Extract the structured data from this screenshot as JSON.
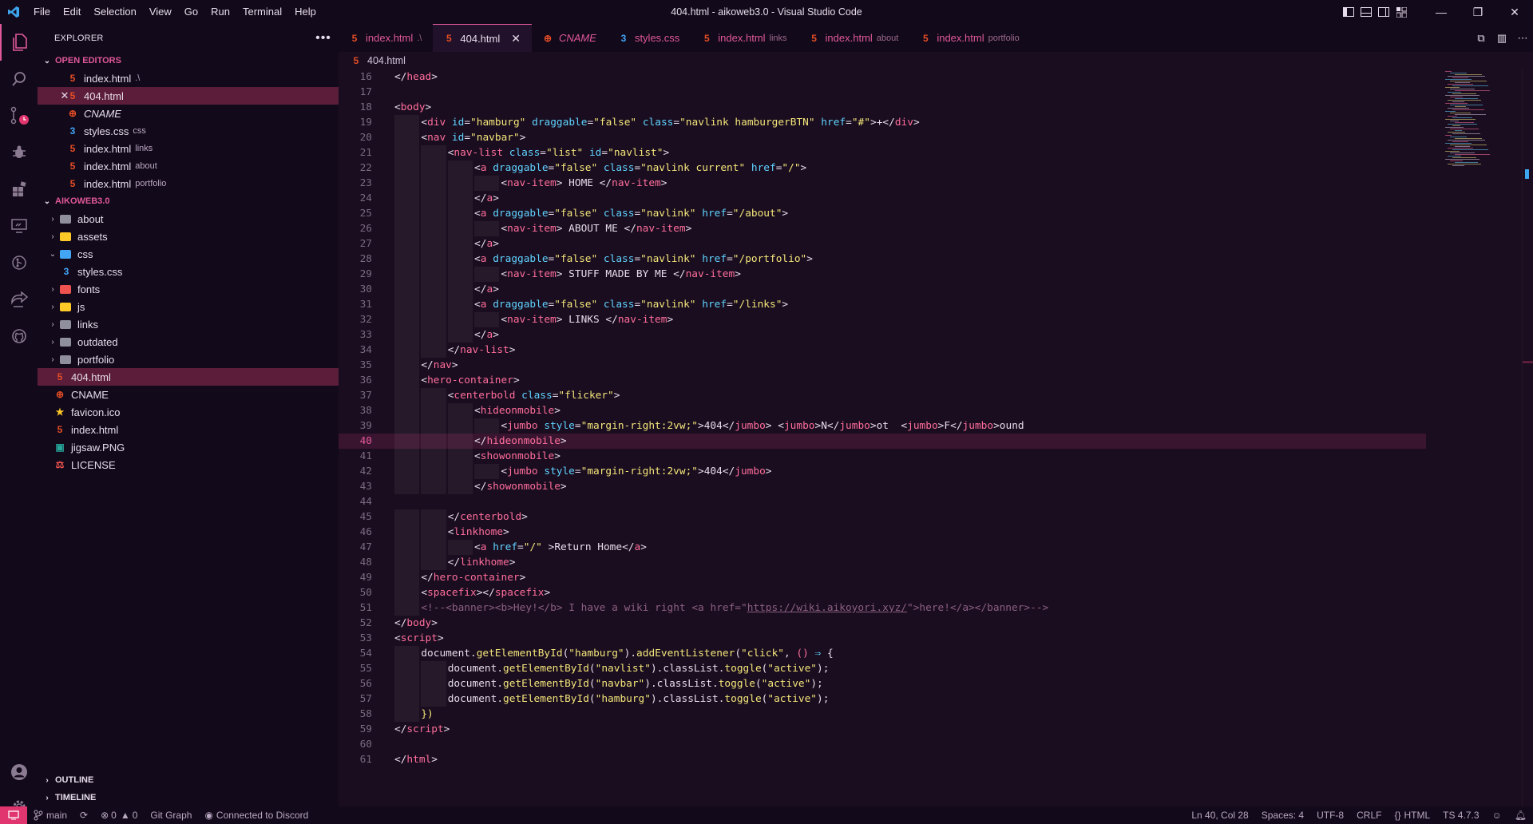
{
  "app": {
    "window_title": "404.html - aikoweb3.0 - Visual Studio Code",
    "menu": [
      "File",
      "Edit",
      "Selection",
      "View",
      "Go",
      "Run",
      "Terminal",
      "Help"
    ],
    "window_controls": {
      "minimize": "—",
      "restore": "❐",
      "close": "✕"
    }
  },
  "sidebar": {
    "title": "EXPLORER",
    "open_editors_label": "OPEN EDITORS",
    "open_editors": [
      {
        "name": "index.html",
        "desc": ".\\",
        "icon": "html-file-icon"
      },
      {
        "name": "404.html",
        "desc": "",
        "icon": "html-file-icon",
        "selected": true
      },
      {
        "name": "CNAME",
        "desc": "",
        "icon": "cname-file-icon"
      },
      {
        "name": "styles.css",
        "desc": "css",
        "icon": "css-file-icon"
      },
      {
        "name": "index.html",
        "desc": "links",
        "icon": "html-file-icon"
      },
      {
        "name": "index.html",
        "desc": "about",
        "icon": "html-file-icon"
      },
      {
        "name": "index.html",
        "desc": "portfolio",
        "icon": "html-file-icon"
      }
    ],
    "workspace_label": "AIKOWEB3.0",
    "tree": [
      {
        "name": "about",
        "type": "folder",
        "color": "#8f8f9e"
      },
      {
        "name": "assets",
        "type": "folder",
        "color": "#ffca28"
      },
      {
        "name": "css",
        "type": "folder-open",
        "color": "#42a5f5"
      },
      {
        "name": "styles.css",
        "type": "file-css",
        "nested": true
      },
      {
        "name": "fonts",
        "type": "folder",
        "color": "#ef5350"
      },
      {
        "name": "js",
        "type": "folder",
        "color": "#ffca28"
      },
      {
        "name": "links",
        "type": "folder",
        "color": "#8f8f9e"
      },
      {
        "name": "outdated",
        "type": "folder",
        "color": "#8f8f9e"
      },
      {
        "name": "portfolio",
        "type": "folder",
        "color": "#8f8f9e"
      },
      {
        "name": "404.html",
        "type": "file-html",
        "selected": true
      },
      {
        "name": "CNAME",
        "type": "file-cname"
      },
      {
        "name": "favicon.ico",
        "type": "file-star"
      },
      {
        "name": "index.html",
        "type": "file-html"
      },
      {
        "name": "jigsaw.PNG",
        "type": "file-image"
      },
      {
        "name": "LICENSE",
        "type": "file-license"
      }
    ],
    "outline_label": "OUTLINE",
    "timeline_label": "TIMELINE"
  },
  "tabs": [
    {
      "name": "index.html",
      "desc": ".\\",
      "active": false
    },
    {
      "name": "404.html",
      "desc": "",
      "active": true
    },
    {
      "name": "CNAME",
      "desc": "",
      "active": false,
      "italic": true
    },
    {
      "name": "styles.css",
      "desc": "",
      "active": false
    },
    {
      "name": "index.html",
      "desc": "links",
      "active": false
    },
    {
      "name": "index.html",
      "desc": "about",
      "active": false
    },
    {
      "name": "index.html",
      "desc": "portfolio",
      "active": false
    }
  ],
  "breadcrumb": "404.html",
  "code": {
    "current_line": 40,
    "lines": [
      {
        "n": 16,
        "indent": 0,
        "html": "<span class='pt'>&lt;/</span><span class='tg'>head</span><span class='pt'>&gt;</span>"
      },
      {
        "n": 17,
        "indent": 0,
        "html": ""
      },
      {
        "n": 18,
        "indent": 0,
        "html": "<span class='pt'>&lt;</span><span class='tg'>body</span><span class='pt'>&gt;</span>"
      },
      {
        "n": 19,
        "indent": 1,
        "html": "<span class='pt'>&lt;</span><span class='tg'>div</span> <span class='at'>id</span>=<span class='st'>\"hamburg\"</span> <span class='at'>draggable</span>=<span class='st'>\"false\"</span> <span class='at'>class</span>=<span class='st'>\"navlink hamburgerBTN\"</span> <span class='at'>href</span>=<span class='st'>\"#\"</span><span class='pt'>&gt;</span>+<span class='pt'>&lt;/</span><span class='tg'>div</span><span class='pt'>&gt;</span>"
      },
      {
        "n": 20,
        "indent": 1,
        "html": "<span class='pt'>&lt;</span><span class='tg'>nav</span> <span class='at'>id</span>=<span class='st'>\"navbar\"</span><span class='pt'>&gt;</span>"
      },
      {
        "n": 21,
        "indent": 2,
        "html": "<span class='pt'>&lt;</span><span class='tg'>nav-list</span> <span class='at'>class</span>=<span class='st'>\"list\"</span> <span class='at'>id</span>=<span class='st'>\"navlist\"</span><span class='pt'>&gt;</span>"
      },
      {
        "n": 22,
        "indent": 3,
        "html": "<span class='pt'>&lt;</span><span class='tg'>a</span> <span class='at'>draggable</span>=<span class='st'>\"false\"</span> <span class='at'>class</span>=<span class='st'>\"navlink current\"</span> <span class='at'>href</span>=<span class='st'>\"/\"</span><span class='pt'>&gt;</span>"
      },
      {
        "n": 23,
        "indent": 4,
        "html": "<span class='pt'>&lt;</span><span class='tg'>nav-item</span><span class='pt'>&gt;</span> HOME <span class='pt'>&lt;/</span><span class='tg'>nav-item</span><span class='pt'>&gt;</span>"
      },
      {
        "n": 24,
        "indent": 3,
        "html": "<span class='pt'>&lt;/</span><span class='tg'>a</span><span class='pt'>&gt;</span>"
      },
      {
        "n": 25,
        "indent": 3,
        "html": "<span class='pt'>&lt;</span><span class='tg'>a</span> <span class='at'>draggable</span>=<span class='st'>\"false\"</span> <span class='at'>class</span>=<span class='st'>\"navlink\"</span> <span class='at'>href</span>=<span class='st'>\"/about\"</span><span class='pt'>&gt;</span>"
      },
      {
        "n": 26,
        "indent": 4,
        "html": "<span class='pt'>&lt;</span><span class='tg'>nav-item</span><span class='pt'>&gt;</span> ABOUT ME <span class='pt'>&lt;/</span><span class='tg'>nav-item</span><span class='pt'>&gt;</span>"
      },
      {
        "n": 27,
        "indent": 3,
        "html": "<span class='pt'>&lt;/</span><span class='tg'>a</span><span class='pt'>&gt;</span>"
      },
      {
        "n": 28,
        "indent": 3,
        "html": "<span class='pt'>&lt;</span><span class='tg'>a</span> <span class='at'>draggable</span>=<span class='st'>\"false\"</span> <span class='at'>class</span>=<span class='st'>\"navlink\"</span> <span class='at'>href</span>=<span class='st'>\"/portfolio\"</span><span class='pt'>&gt;</span>"
      },
      {
        "n": 29,
        "indent": 4,
        "html": "<span class='pt'>&lt;</span><span class='tg'>nav-item</span><span class='pt'>&gt;</span> STUFF MADE BY ME <span class='pt'>&lt;/</span><span class='tg'>nav-item</span><span class='pt'>&gt;</span>"
      },
      {
        "n": 30,
        "indent": 3,
        "html": "<span class='pt'>&lt;/</span><span class='tg'>a</span><span class='pt'>&gt;</span>"
      },
      {
        "n": 31,
        "indent": 3,
        "html": "<span class='pt'>&lt;</span><span class='tg'>a</span> <span class='at'>draggable</span>=<span class='st'>\"false\"</span> <span class='at'>class</span>=<span class='st'>\"navlink\"</span> <span class='at'>href</span>=<span class='st'>\"/links\"</span><span class='pt'>&gt;</span>"
      },
      {
        "n": 32,
        "indent": 4,
        "html": "<span class='pt'>&lt;</span><span class='tg'>nav-item</span><span class='pt'>&gt;</span> LINKS <span class='pt'>&lt;/</span><span class='tg'>nav-item</span><span class='pt'>&gt;</span>"
      },
      {
        "n": 33,
        "indent": 3,
        "html": "<span class='pt'>&lt;/</span><span class='tg'>a</span><span class='pt'>&gt;</span>"
      },
      {
        "n": 34,
        "indent": 2,
        "html": "<span class='pt'>&lt;/</span><span class='tg'>nav-list</span><span class='pt'>&gt;</span>"
      },
      {
        "n": 35,
        "indent": 1,
        "html": "<span class='pt'>&lt;/</span><span class='tg'>nav</span><span class='pt'>&gt;</span>"
      },
      {
        "n": 36,
        "indent": 1,
        "html": "<span class='pt'>&lt;</span><span class='tg'>hero-container</span><span class='pt'>&gt;</span>"
      },
      {
        "n": 37,
        "indent": 2,
        "html": "<span class='pt'>&lt;</span><span class='tg'>centerbold</span> <span class='at'>class</span>=<span class='st'>\"flicker\"</span><span class='pt'>&gt;</span>"
      },
      {
        "n": 38,
        "indent": 3,
        "html": "<span class='pt'>&lt;</span><span class='tg'>hideonmobile</span><span class='pt'>&gt;</span>"
      },
      {
        "n": 39,
        "indent": 4,
        "html": "<span class='pt'>&lt;</span><span class='tg'>jumbo</span> <span class='at'>style</span>=<span class='st'>\"margin-right:2vw;\"</span><span class='pt'>&gt;</span>404<span class='pt'>&lt;/</span><span class='tg'>jumbo</span><span class='pt'>&gt;</span> <span class='pt'>&lt;</span><span class='tg'>jumbo</span><span class='pt'>&gt;</span>N<span class='pt'>&lt;/</span><span class='tg'>jumbo</span><span class='pt'>&gt;</span>ot  <span class='pt'>&lt;</span><span class='tg'>jumbo</span><span class='pt'>&gt;</span>F<span class='pt'>&lt;/</span><span class='tg'>jumbo</span><span class='pt'>&gt;</span>ound"
      },
      {
        "n": 40,
        "indent": 3,
        "html": "<span class='pt'>&lt;/</span><span class='tg'>hideonmobile</span><span class='pt'>&gt;</span>"
      },
      {
        "n": 41,
        "indent": 3,
        "html": "<span class='pt'>&lt;</span><span class='tg'>showonmobile</span><span class='pt'>&gt;</span>"
      },
      {
        "n": 42,
        "indent": 4,
        "html": "<span class='pt'>&lt;</span><span class='tg'>jumbo</span> <span class='at'>style</span>=<span class='st'>\"margin-right:2vw;\"</span><span class='pt'>&gt;</span>404<span class='pt'>&lt;/</span><span class='tg'>jumbo</span><span class='pt'>&gt;</span>"
      },
      {
        "n": 43,
        "indent": 3,
        "html": "<span class='pt'>&lt;/</span><span class='tg'>showonmobile</span><span class='pt'>&gt;</span>"
      },
      {
        "n": 44,
        "indent": 0,
        "html": ""
      },
      {
        "n": 45,
        "indent": 2,
        "html": "<span class='pt'>&lt;/</span><span class='tg'>centerbold</span><span class='pt'>&gt;</span>"
      },
      {
        "n": 46,
        "indent": 2,
        "html": "<span class='pt'>&lt;</span><span class='tg'>linkhome</span><span class='pt'>&gt;</span>"
      },
      {
        "n": 47,
        "indent": 3,
        "html": "<span class='pt'>&lt;</span><span class='tg'>a</span> <span class='at'>href</span>=<span class='st'>\"/\"</span> <span class='pt'>&gt;</span>Return Home<span class='pt'>&lt;/</span><span class='tg'>a</span><span class='pt'>&gt;</span>"
      },
      {
        "n": 48,
        "indent": 2,
        "html": "<span class='pt'>&lt;/</span><span class='tg'>linkhome</span><span class='pt'>&gt;</span>"
      },
      {
        "n": 49,
        "indent": 1,
        "html": "<span class='pt'>&lt;/</span><span class='tg'>hero-container</span><span class='pt'>&gt;</span>"
      },
      {
        "n": 50,
        "indent": 1,
        "html": "<span class='pt'>&lt;</span><span class='tg'>spacefix</span><span class='pt'>&gt;&lt;/</span><span class='tg'>spacefix</span><span class='pt'>&gt;</span>"
      },
      {
        "n": 51,
        "indent": 1,
        "html": "<span class='cm'>&lt;!--&lt;banner&gt;&lt;b&gt;Hey!&lt;/b&gt; I have a wiki right &lt;a href=\"<u>https://wiki.aikoyori.xyz/</u>\"&gt;here!&lt;/a&gt;&lt;/banner&gt;--&gt;</span>"
      },
      {
        "n": 52,
        "indent": 0,
        "html": "<span class='pt'>&lt;/</span><span class='tg'>body</span><span class='pt'>&gt;</span>"
      },
      {
        "n": 53,
        "indent": 0,
        "html": "<span class='pt'>&lt;</span><span class='tg'>script</span><span class='pt'>&gt;</span>"
      },
      {
        "n": 54,
        "indent": 1,
        "html": "document.<span class='fn'>getElementById</span>(<span class='st'>\"hamburg\"</span>).<span class='fn'>addEventListener</span>(<span class='st'>\"click\"</span>, <span class='tg'>()</span> <span class='at'>⇒</span> {"
      },
      {
        "n": 55,
        "indent": 2,
        "html": "document.<span class='fn'>getElementById</span>(<span class='st'>\"navlist\"</span>).classList.<span class='fn'>toggle</span>(<span class='st'>\"active\"</span>);"
      },
      {
        "n": 56,
        "indent": 2,
        "html": "document.<span class='fn'>getElementById</span>(<span class='st'>\"navbar\"</span>).classList.<span class='fn'>toggle</span>(<span class='st'>\"active\"</span>);"
      },
      {
        "n": 57,
        "indent": 2,
        "html": "document.<span class='fn'>getElementById</span>(<span class='st'>\"hamburg\"</span>).classList.<span class='fn'>toggle</span>(<span class='st'>\"active\"</span>);"
      },
      {
        "n": 58,
        "indent": 1,
        "html": "<span class='fn'>})</span>"
      },
      {
        "n": 59,
        "indent": 0,
        "html": "<span class='pt'>&lt;/</span><span class='tg'>script</span><span class='pt'>&gt;</span>"
      },
      {
        "n": 60,
        "indent": 0,
        "html": ""
      },
      {
        "n": 61,
        "indent": 0,
        "html": "<span class='pt'>&lt;/</span><span class='tg'>html</span><span class='pt'>&gt;</span>"
      }
    ]
  },
  "status": {
    "branch": "main",
    "errors": "0",
    "warnings": "0",
    "git_graph": "Git Graph",
    "discord": "Connected to Discord",
    "position": "Ln 40, Col 28",
    "spaces": "Spaces: 4",
    "encoding": "UTF-8",
    "eol": "CRLF",
    "language": "HTML",
    "ts_version": "TS 4.7.3"
  },
  "accounts_badge": "1",
  "colors": {
    "accent": "#e0589a",
    "background": "#1a0d1f",
    "sidebar": "#12091a",
    "selection": "#5c1d3a"
  }
}
